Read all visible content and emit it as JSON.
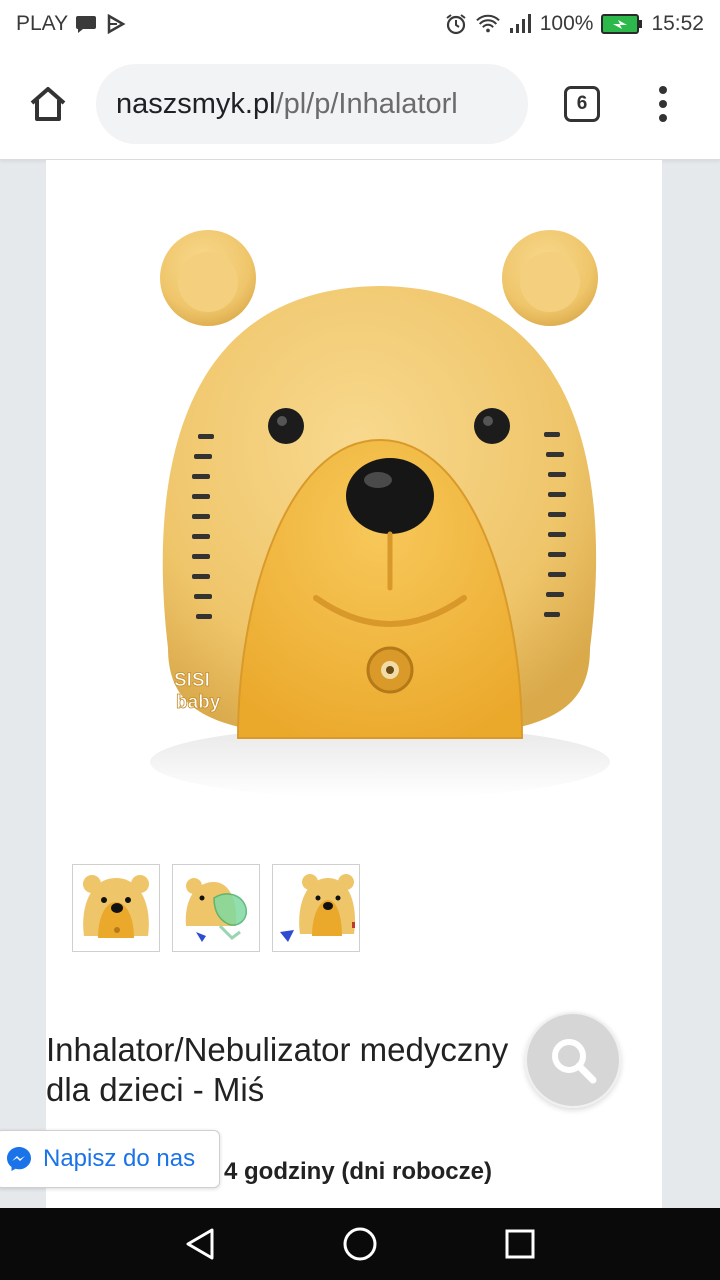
{
  "status_bar": {
    "carrier": "PLAY",
    "battery": "100%",
    "time": "15:52"
  },
  "browser": {
    "url_domain": "naszsmyk.pl",
    "url_path": "/pl/p/Inhalatorl",
    "tab_count": "6"
  },
  "product": {
    "image_logo_text": "SISI baby",
    "title_line1": "Inhalator/Nebulizator medyczny",
    "title_line2": "dla dzieci - Miś",
    "delivery_text": "4 godziny (dni robocze)",
    "thumbnails": [
      "bear-front",
      "bear-with-mask",
      "bear-side"
    ]
  },
  "chat": {
    "label": "Napisz do nas"
  },
  "colors": {
    "bear_body": "#f1c66e",
    "bear_face": "#f2b63c",
    "messenger_blue": "#1a73e8"
  }
}
